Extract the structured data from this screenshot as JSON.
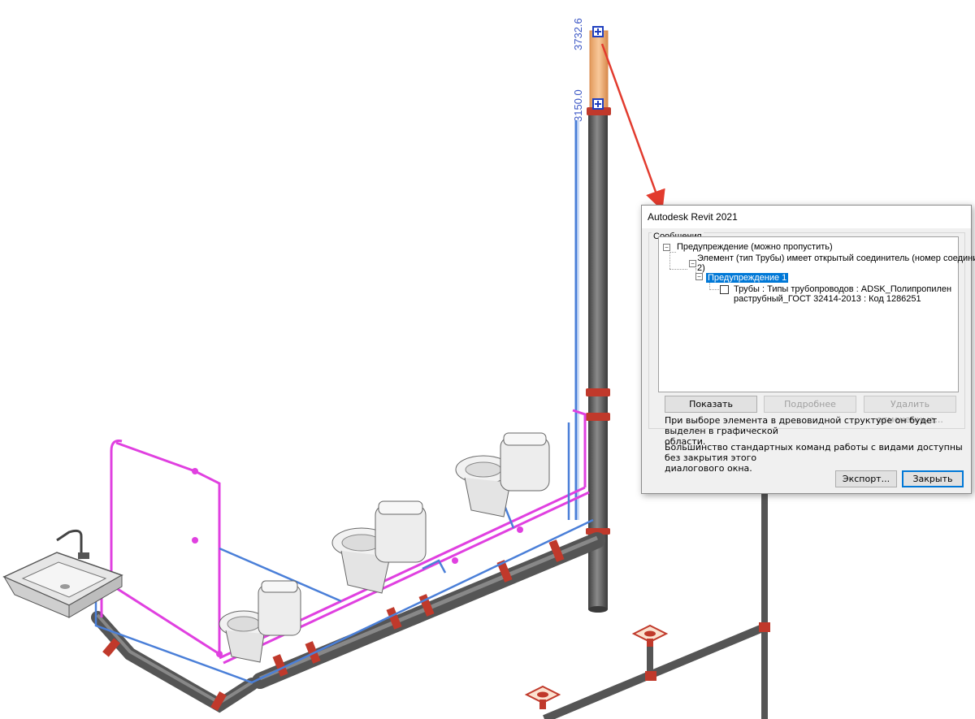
{
  "viewport": {
    "dimension_top": "3732.6",
    "dimension_mid": "3150.0"
  },
  "dialog": {
    "title": "Autodesk Revit 2021",
    "group_label": "Сообщения",
    "tree": {
      "root": "Предупреждение (можно пропустить)",
      "child_line1": "Элемент (тип Трубы) имеет открытый соединитель (номер соединителя",
      "child_line2": "2)",
      "warning": "Предупреждение 1",
      "item_line1": "Трубы : Типы трубопроводов : ADSK_Полипропилен",
      "item_line2": "раструбный_ГОСТ 32414-2013 : Код 1286251"
    },
    "buttons": {
      "show": "Показать",
      "details": "Подробнее",
      "delete_checked": "Удалить отмеченные...",
      "export": "Экспорт...",
      "close": "Закрыть"
    },
    "info1_line1": "При выборе элемента в древовидной структуре он будет выделен в графической",
    "info1_line2": "области.",
    "info2_line1": "Большинство стандартных команд работы с видами доступны без закрытия этого",
    "info2_line2": "диалогового окна."
  },
  "colors": {
    "pipe_gray": "#5a5a5a",
    "fitting_red": "#c0392b",
    "hot_water": "#e040e0",
    "cold_water": "#4a7fd8",
    "selected_pipe": "#f3b07a",
    "arrow": "#e23b2e",
    "selection_blue": "#0078d7"
  }
}
